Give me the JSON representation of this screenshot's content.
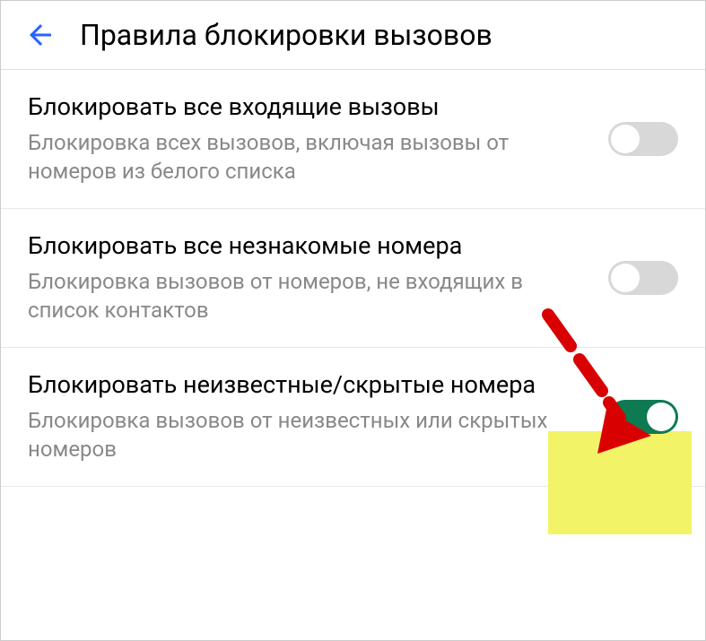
{
  "header": {
    "title": "Правила блокировки вызовов"
  },
  "settings": [
    {
      "title": "Блокировать все входящие вызовы",
      "description": "Блокировка всех вызовов, включая вызовы от номеров из белого списка",
      "enabled": false
    },
    {
      "title": "Блокировать все незнакомые номера",
      "description": "Блокировка вызовов от номеров, не входящих в список контактов",
      "enabled": false
    },
    {
      "title": "Блокировать неизвестные/скрытые номера",
      "description": "Блокировка вызовов от неизвестных или скрытых номеров",
      "enabled": true
    }
  ]
}
